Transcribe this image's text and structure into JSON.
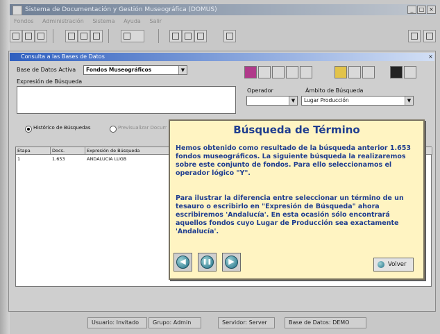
{
  "app": {
    "title": "Sistema de Documentación y Gestión Museográfica (DOMUS)",
    "menu": [
      "Fondos",
      "Administración",
      "Sistema",
      "Ayuda",
      "Salir"
    ],
    "window_controls": [
      "_",
      "□",
      "×"
    ]
  },
  "search_window": {
    "title": "Consulta a las Bases de Datos",
    "close_label": "×",
    "db_label": "Base de Datos Activa",
    "db_value": "Fondos Museográficos",
    "expression_label": "Expresión de Búsqueda",
    "expression_value": "",
    "operator_label": "Operador",
    "operator_value": "",
    "scope_label": "Ámbito de Búsqueda",
    "scope_value": "Lugar Producción",
    "history_radio_label": "Histórico de Búsquedas",
    "other_radio_label": "Previsualizar Documentos",
    "history_table": {
      "columns": [
        "Etapa",
        "Docs.",
        "Expresión de Búsqueda"
      ],
      "rows": [
        [
          "1",
          "1.653",
          "ANDALUCIA LUGB"
        ]
      ]
    }
  },
  "popup": {
    "title": "Búsqueda de Término",
    "paragraph1": "Hemos obtenido como resultado de la búsqueda anterior 1.653 fondos museográficos. La siguiente búsqueda la realizaremos sobre este conjunto de fondos. Para ello seleccionamos el operador lógico \"Y\".",
    "paragraph2": "Para ilustrar la diferencia entre seleccionar un término de un tesauro o escribirlo en \"Expresión de Búsqueda\" ahora escribiremos 'Andalucía'. En esta ocasión sólo encontrará aquellos fondos cuyo Lugar de Producción sea exactamente 'Andalucía'.",
    "prev_glyph": "◀",
    "pause_glyph": "❚❚",
    "next_glyph": "▶",
    "back_label": "Volver"
  },
  "statusbar": {
    "user": "Usuario: Invitado",
    "group": "Grupo: Admin",
    "server": "Servidor: Server",
    "database": "Base de Datos: DEMO"
  },
  "colors": {
    "popup_background": "#fff4c2",
    "popup_text": "#1f3d8f",
    "inner_title_start": "#2f5fbf"
  }
}
